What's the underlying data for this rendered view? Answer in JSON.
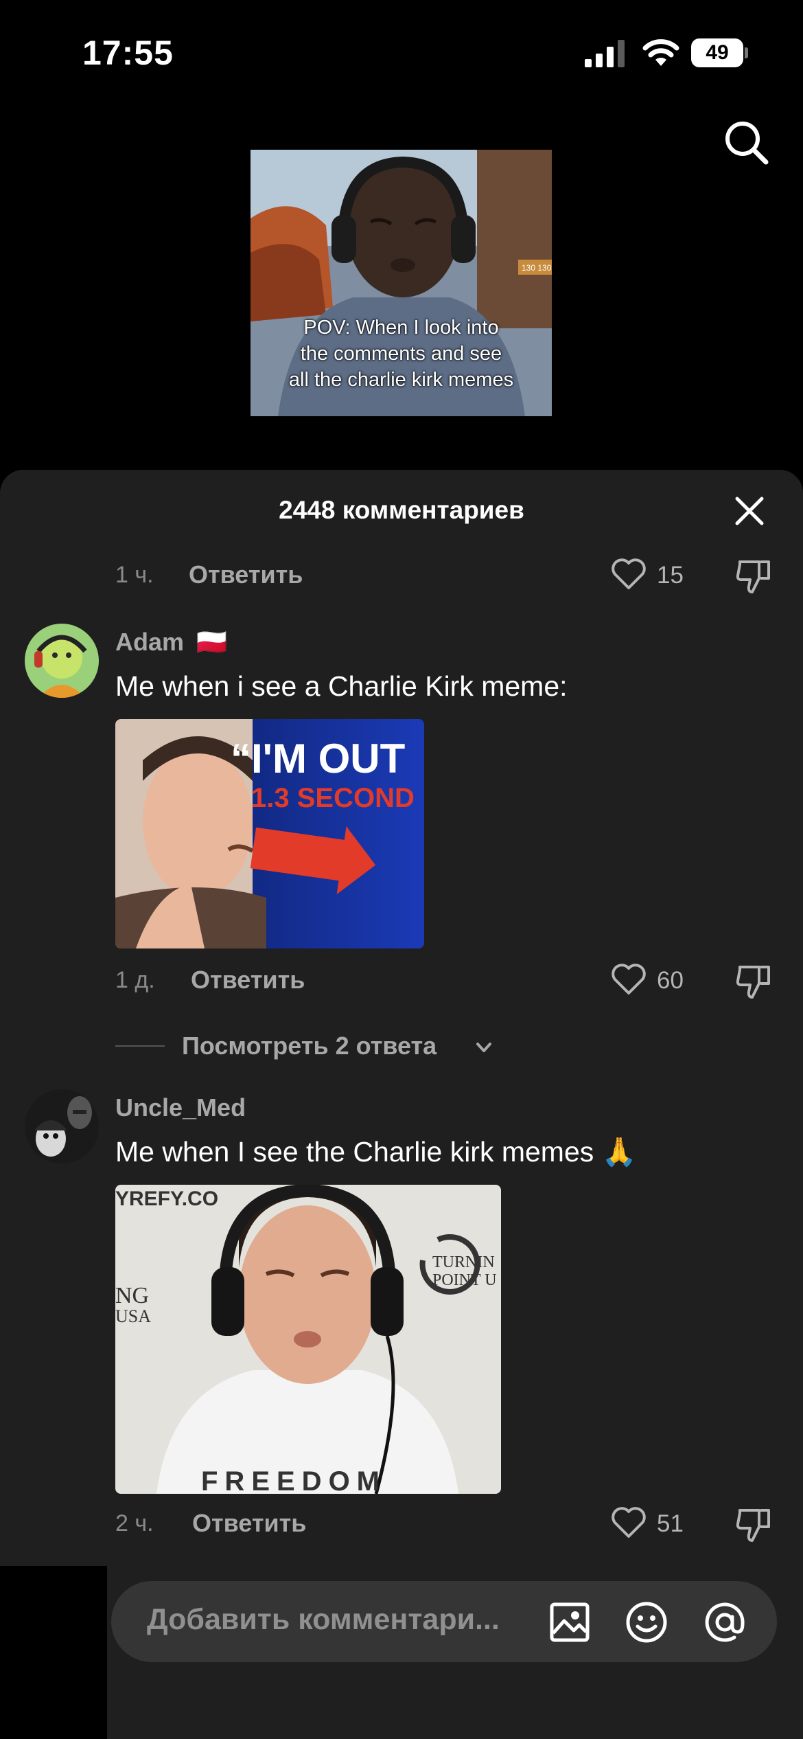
{
  "status_bar": {
    "time": "17:55",
    "battery": "49"
  },
  "video": {
    "caption_lines": [
      "POV: When I look into",
      "the comments and see",
      "all the charlie kirk memes"
    ],
    "badge": "130  130"
  },
  "sheet": {
    "title": "2448 комментариев"
  },
  "prev_comment": {
    "time": "1 ч.",
    "reply_label": "Ответить",
    "likes": "15"
  },
  "comments": [
    {
      "username": "Adam",
      "flag": "🇵🇱",
      "text": "Me when i see a Charlie Kirk meme:",
      "image_text_line1": "“I'M OUT",
      "image_text_line2": "1.3 SECOND",
      "time": "1 д.",
      "reply_label": "Ответить",
      "likes": "60",
      "view_replies": "Посмотреть 2 ответа"
    },
    {
      "username": "Uncle_Med",
      "text": "Me when I see the Charlie kirk memes 🙏",
      "image_text_top": "YREFY.CO",
      "image_text_left1": "NG",
      "image_text_left2": "USA",
      "image_text_right1": "TURNIN",
      "image_text_right2": "POINT U",
      "image_text_shirt": "FREEDOM",
      "time": "2 ч.",
      "reply_label": "Ответить",
      "likes": "51"
    }
  ],
  "composer": {
    "placeholder": "Добавить комментари..."
  },
  "icons": [
    "signal-icon",
    "wifi-icon",
    "battery-icon",
    "search-icon",
    "close-icon",
    "heart-icon",
    "dislike-icon",
    "chevron-down-icon",
    "image-icon",
    "emoji-icon",
    "mention-icon"
  ]
}
